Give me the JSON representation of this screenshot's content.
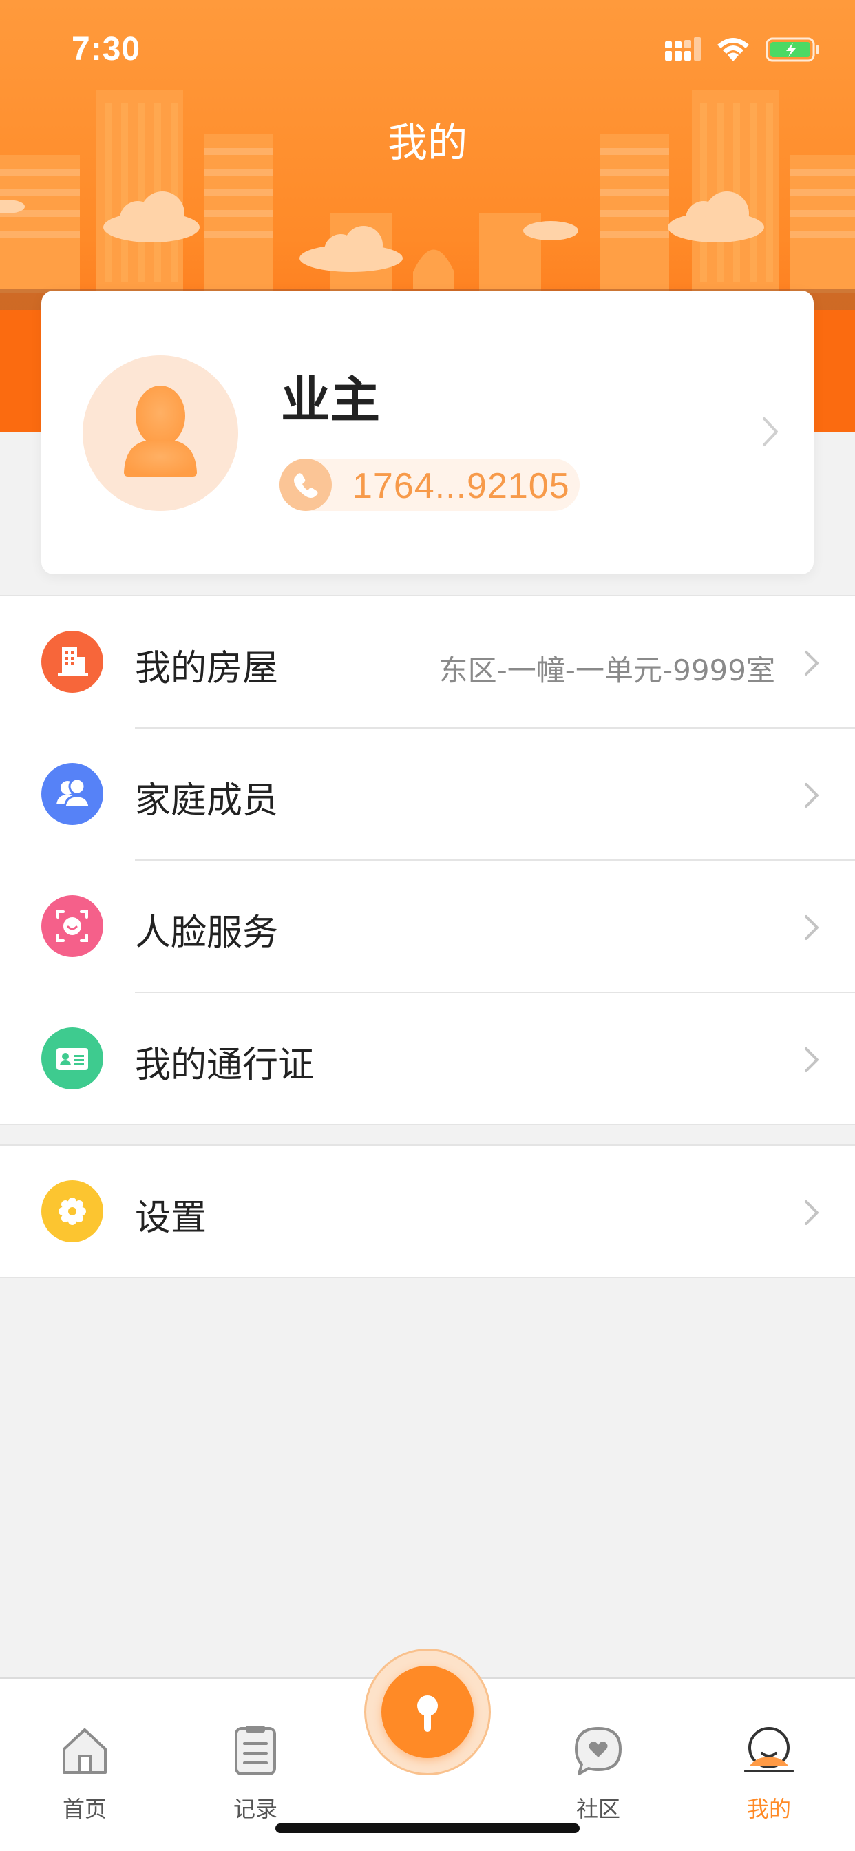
{
  "status_bar": {
    "time": "7:30",
    "icons": [
      "signal-icon",
      "wifi-icon",
      "battery-charging-icon"
    ]
  },
  "header": {
    "title": "我的",
    "background_color": "#ff8a28"
  },
  "profile": {
    "name": "业主",
    "phone": "1764...92105",
    "avatar_icon": "user-avatar-icon",
    "phone_icon": "phone-icon"
  },
  "menu": {
    "group1": [
      {
        "label": "我的房屋",
        "value": "东区-一幢-一单元-9999室",
        "icon": "building-icon",
        "color": "#f7663a"
      },
      {
        "label": "家庭成员",
        "value": "",
        "icon": "family-members-icon",
        "color": "#5682f7"
      },
      {
        "label": "人脸服务",
        "value": "",
        "icon": "face-scan-icon",
        "color": "#f5608a"
      },
      {
        "label": "我的通行证",
        "value": "",
        "icon": "id-card-icon",
        "color": "#3ecb8f"
      }
    ],
    "group2": [
      {
        "label": "设置",
        "value": "",
        "icon": "settings-gear-icon",
        "color": "#fcc530"
      }
    ]
  },
  "tab_bar": {
    "tabs": [
      {
        "label": "首页",
        "icon": "home-icon",
        "active": false
      },
      {
        "label": "记录",
        "icon": "record-list-icon",
        "active": false
      },
      {
        "label": "社区",
        "icon": "community-chat-icon",
        "active": false
      },
      {
        "label": "我的",
        "icon": "profile-tab-icon",
        "active": true
      }
    ],
    "center_button_icon": "keyhole-unlock-icon",
    "accent_color": "#ff8a26"
  }
}
